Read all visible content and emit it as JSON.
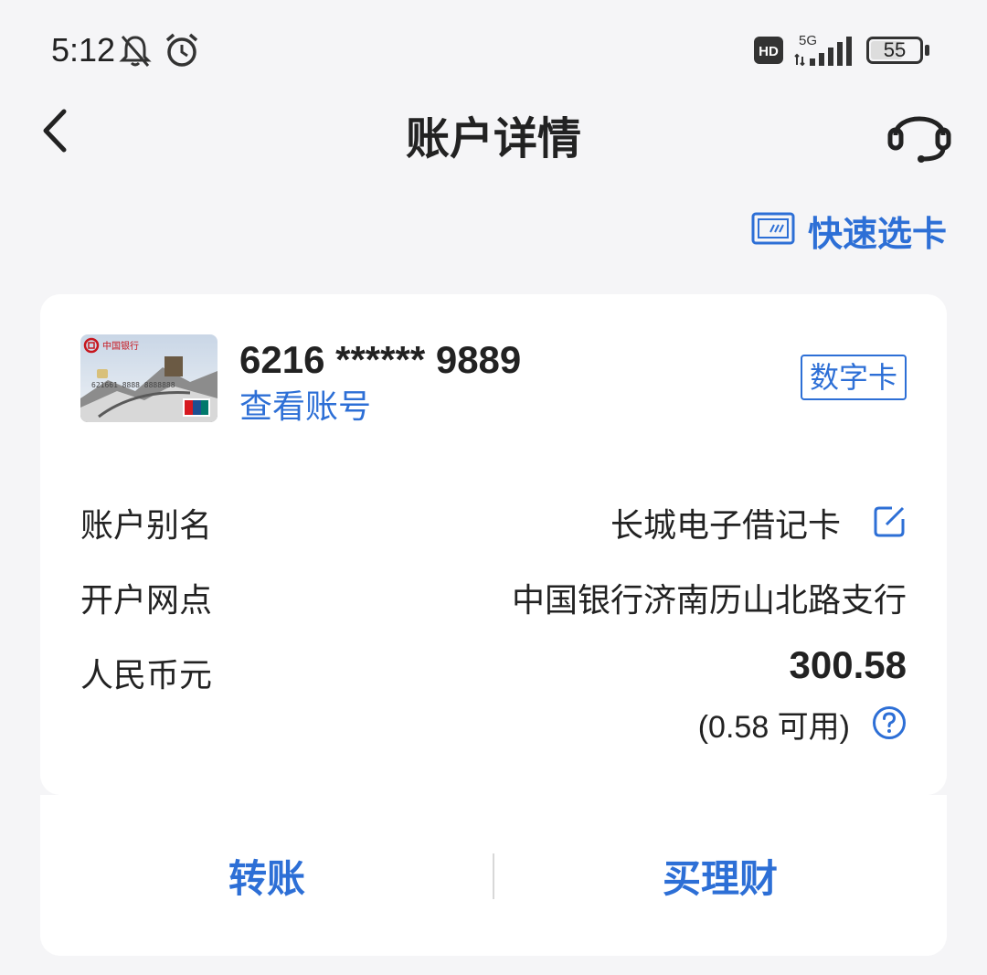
{
  "status_bar": {
    "time": "5:12",
    "network": "5G",
    "hd": "HD",
    "battery": "55",
    "icons": [
      "bell-muted-icon",
      "alarm-icon",
      "hd-icon",
      "signal-icon",
      "battery-icon"
    ]
  },
  "nav": {
    "title": "账户详情",
    "back_icon": "chevron-left-icon",
    "service_icon": "headset-icon"
  },
  "quick_select": {
    "label": "快速选卡",
    "icon": "card-select-icon"
  },
  "card": {
    "number": "6216 ****** 9889",
    "view_account": "查看账号",
    "badge": "数字卡",
    "image_text": "中国银行",
    "image_card_no": "621661 8888 8888888"
  },
  "details": {
    "alias_label": "账户别名",
    "alias_value": "长城电子借记卡",
    "branch_label": "开户网点",
    "branch_value": "中国银行济南历山北路支行",
    "currency_label": "人民币元",
    "balance": "300.58",
    "available": "(0.58 可用)"
  },
  "actions": {
    "transfer": "转账",
    "wealth": "买理财"
  },
  "colors": {
    "accent": "#2d6fd6",
    "background": "#f5f5f7",
    "card": "#ffffff"
  }
}
